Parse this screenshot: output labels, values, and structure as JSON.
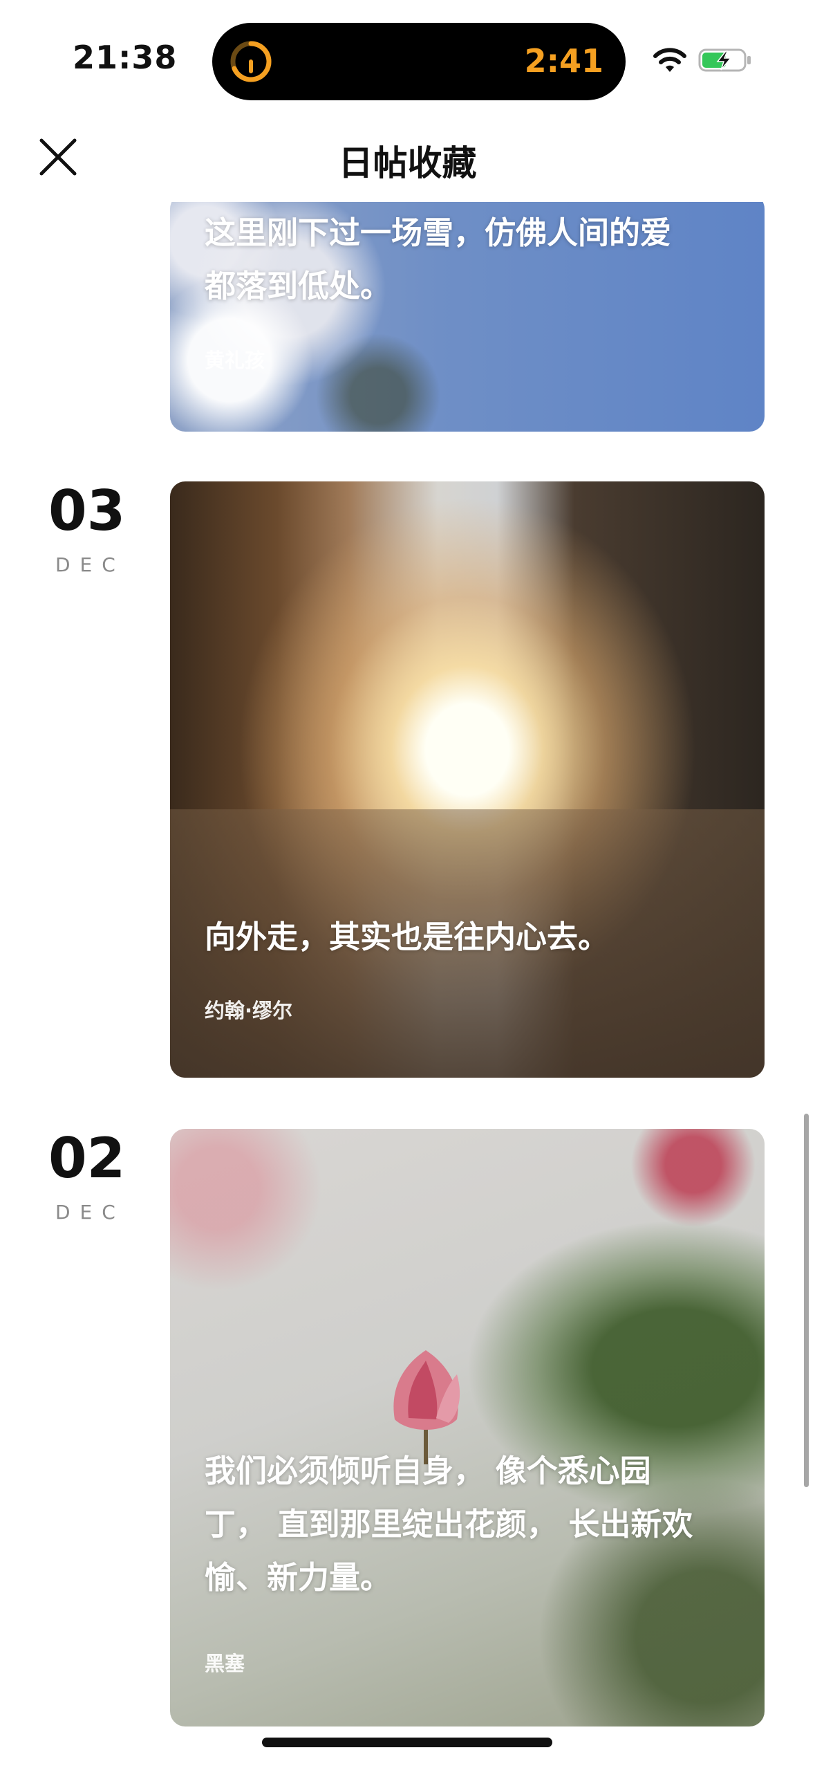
{
  "status_bar": {
    "time": "21:38",
    "live_activity_timer": "2:41",
    "accent_color": "#f5a021",
    "icons": [
      "timer-ring-icon",
      "wifi-icon",
      "battery-charging-icon"
    ]
  },
  "nav": {
    "title": "日帖收藏",
    "close_icon": "close-icon"
  },
  "entries": [
    {
      "quote_lines": [
        "这里刚下过一场雪，仿佛人间的爱",
        "都落到低处。"
      ],
      "author": "黄礼孩"
    },
    {
      "day": "03",
      "month": "DEC",
      "quote_lines": [
        "向外走，其实也是往内心去。"
      ],
      "author": "约翰·缪尔"
    },
    {
      "day": "02",
      "month": "DEC",
      "quote_lines": [
        "我们必须倾听自身， 像个悉心园",
        "丁， 直到那里绽出花颜， 长出新欢",
        "愉、新力量。"
      ],
      "author": "黑塞"
    }
  ]
}
